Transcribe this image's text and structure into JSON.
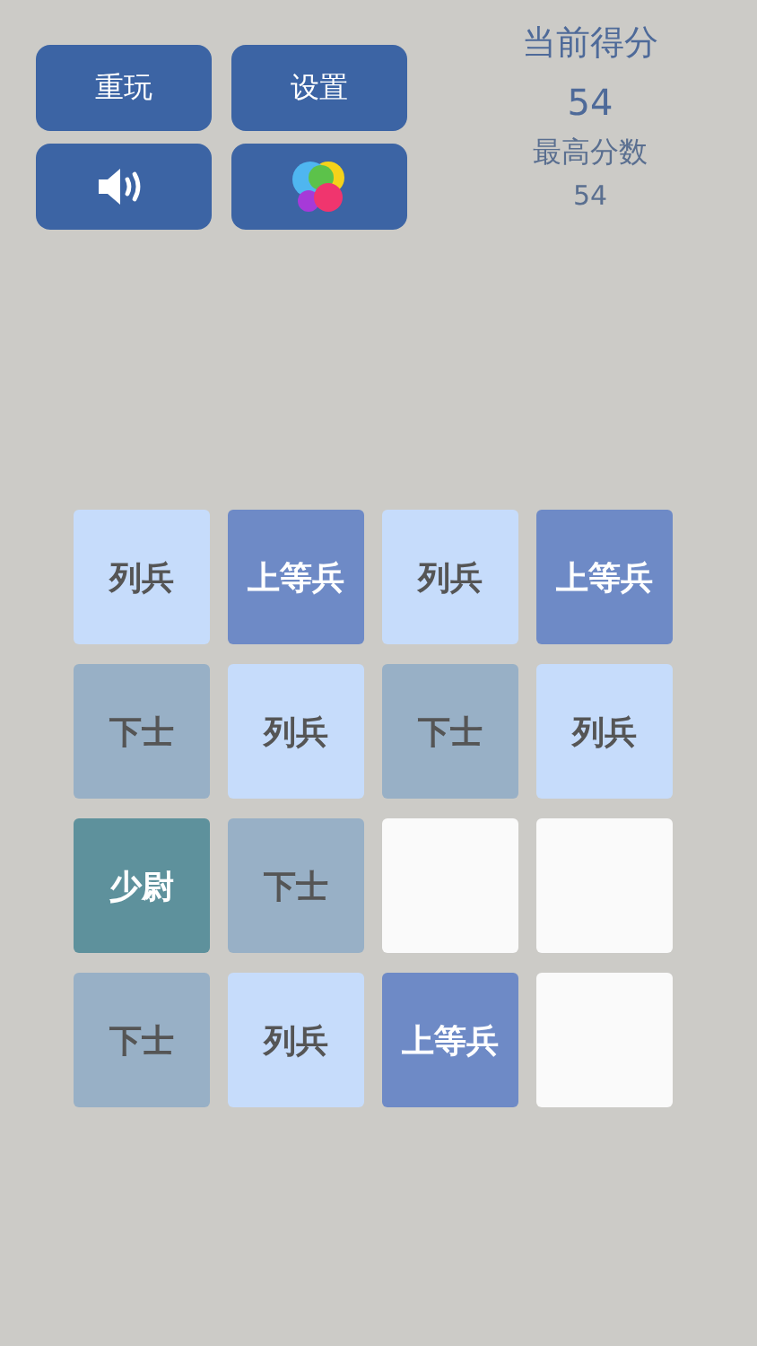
{
  "buttons": [
    {
      "kind": "text",
      "label": "重玩"
    },
    {
      "kind": "text",
      "label": "设置"
    },
    {
      "kind": "sound"
    },
    {
      "kind": "game-center"
    }
  ],
  "score": {
    "current_label": "当前得分",
    "current": "54",
    "best_label": "最高分数",
    "best": "54"
  },
  "board": [
    {
      "kind": "private",
      "label": "列兵"
    },
    {
      "kind": "pfc",
      "label": "上等兵"
    },
    {
      "kind": "private",
      "label": "列兵"
    },
    {
      "kind": "pfc",
      "label": "上等兵"
    },
    {
      "kind": "corporal",
      "label": "下士"
    },
    {
      "kind": "private",
      "label": "列兵"
    },
    {
      "kind": "corporal",
      "label": "下士"
    },
    {
      "kind": "private",
      "label": "列兵"
    },
    {
      "kind": "lieutenant",
      "label": "少尉"
    },
    {
      "kind": "corporal",
      "label": "下士"
    },
    {
      "kind": "empty"
    },
    {
      "kind": "empty"
    },
    {
      "kind": "corporal",
      "label": "下士"
    },
    {
      "kind": "private",
      "label": "列兵"
    },
    {
      "kind": "pfc",
      "label": "上等兵"
    },
    {
      "kind": "empty"
    }
  ]
}
